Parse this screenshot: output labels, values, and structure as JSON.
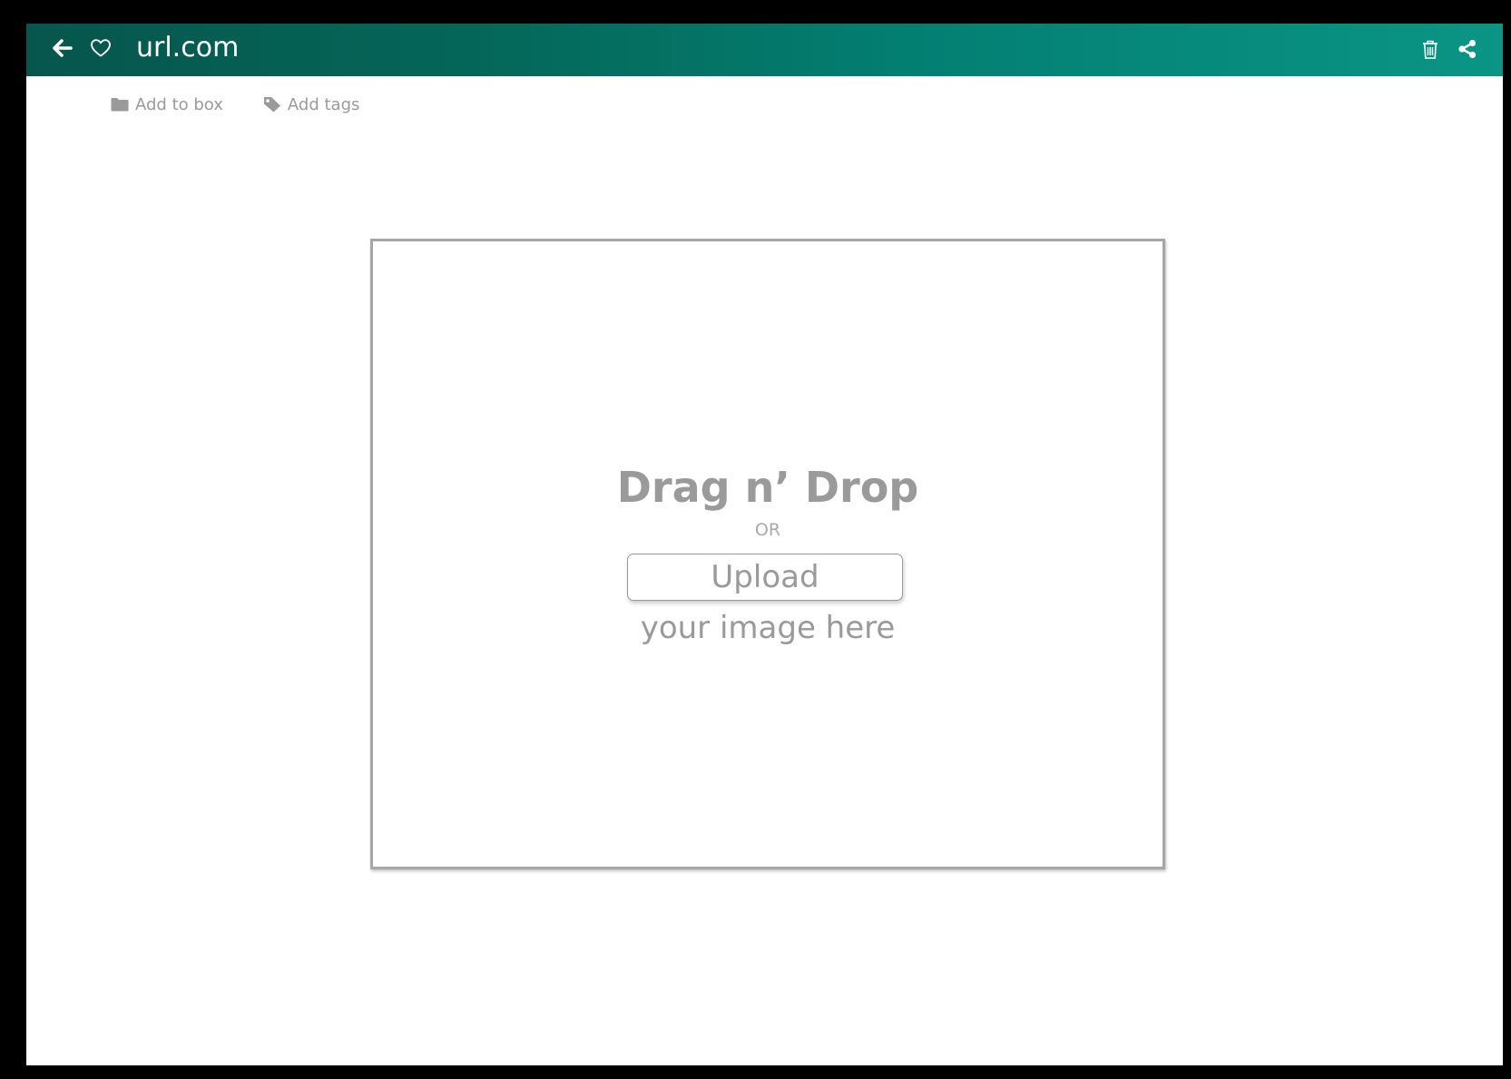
{
  "header": {
    "url": "url.com",
    "back_icon": "arrow-left-icon",
    "favorite_icon": "heart-outline-icon",
    "delete_icon": "trash-icon",
    "share_icon": "share-icon",
    "gradient_colors": [
      "#07564d",
      "#037f72",
      "#0a9585"
    ]
  },
  "actions": {
    "add_to_box": {
      "label": "Add to box",
      "icon": "folder-icon"
    },
    "add_tags": {
      "label": "Add tags",
      "icon": "tag-icon"
    }
  },
  "dropzone": {
    "title": "Drag n’ Drop",
    "or": "OR",
    "upload_label": "Upload",
    "hint": "your image here"
  }
}
